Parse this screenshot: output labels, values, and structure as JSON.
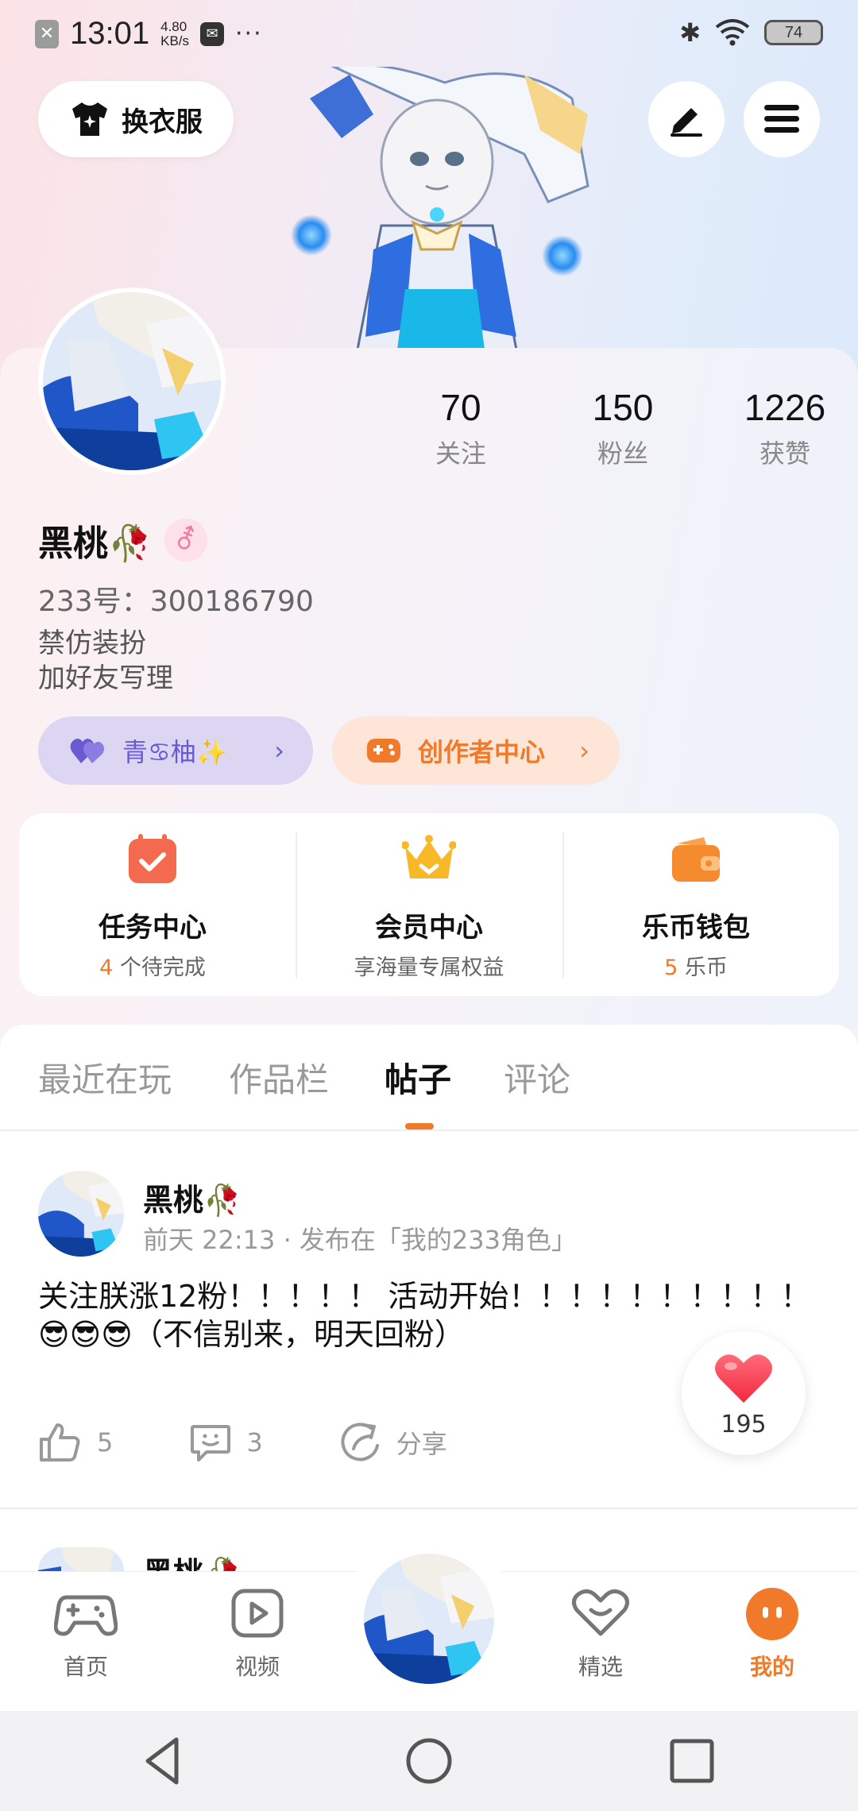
{
  "status_bar": {
    "time": "13:01",
    "speed_value": "4.80",
    "speed_unit": "KB/s",
    "more": "···",
    "battery": "74"
  },
  "header": {
    "outfit_label": "换衣服",
    "edit_icon": "pen-icon",
    "menu_icon": "menu-icon"
  },
  "stats": [
    {
      "value": "70",
      "label": "关注"
    },
    {
      "value": "150",
      "label": "粉丝"
    },
    {
      "value": "1226",
      "label": "获赞"
    }
  ],
  "profile": {
    "username": "黑桃🥀",
    "gender_symbol": "⚦",
    "uid": "233号：300186790",
    "bio_line1": "禁仿装扮",
    "bio_line2": "加好友写理",
    "friend_pill": "青♋柚✨",
    "creator_pill": "创作者中心"
  },
  "services": [
    {
      "title": "任务中心",
      "sub_highlight": "4",
      "sub_rest": " 个待完成"
    },
    {
      "title": "会员中心",
      "sub_highlight": "",
      "sub_rest": "享海量专属权益"
    },
    {
      "title": "乐币钱包",
      "sub_highlight": "5",
      "sub_rest": " 乐币"
    }
  ],
  "tabs": [
    "最近在玩",
    "作品栏",
    "帖子",
    "评论"
  ],
  "active_tab": "帖子",
  "post": {
    "author": "黑桃🥀",
    "meta": "前天 22:13 · 发布在「我的233角色」",
    "body": "关注朕涨12粉！！！！！ 活动开始！！！！！！！！！！😎😎😎（不信别来，明天回粉）",
    "likes": "5",
    "comments": "3",
    "share": "分享"
  },
  "post2_author": "黑桃🥀",
  "floating_like_count": "195",
  "bottom_nav": [
    {
      "label": "首页",
      "icon": "gamepad-icon"
    },
    {
      "label": "视频",
      "icon": "play-icon"
    },
    {
      "label": "精选",
      "icon": "heart-icon"
    },
    {
      "label": "我的",
      "icon": "smile-icon"
    }
  ],
  "colors": {
    "accent": "#f07a2a",
    "friend": "#6a5ad1"
  }
}
